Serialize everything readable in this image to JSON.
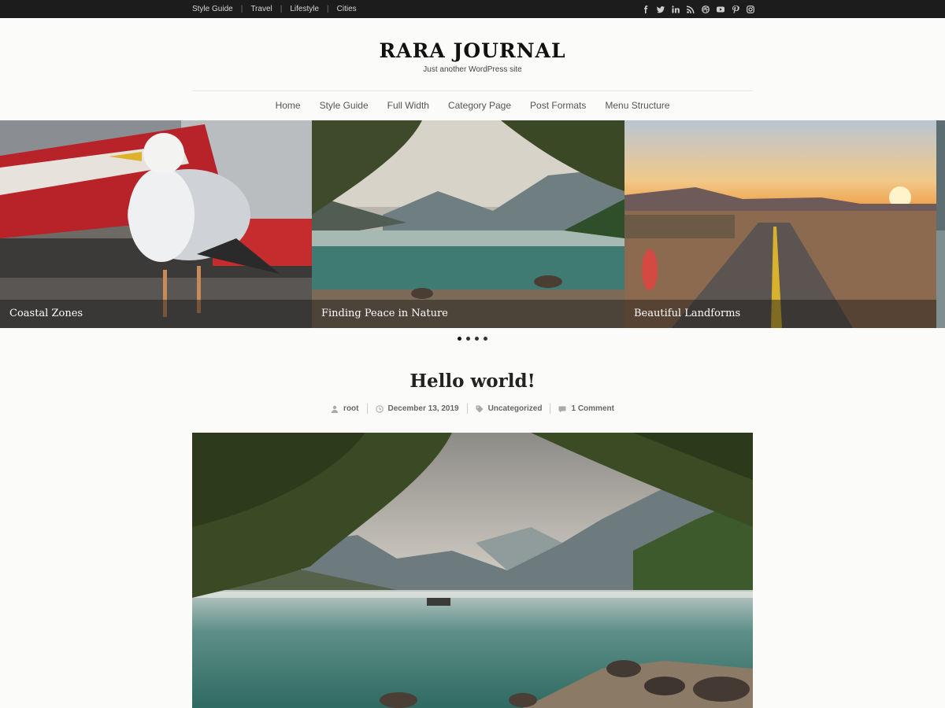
{
  "topbar": {
    "links": [
      "Style Guide",
      "Travel",
      "Lifestyle",
      "Cities"
    ],
    "social_icons": [
      "facebook-icon",
      "twitter-icon",
      "linkedin-icon",
      "rss-icon",
      "dribbble-icon",
      "youtube-icon",
      "pinterest-icon",
      "instagram-icon"
    ]
  },
  "header": {
    "title": "RARA JOURNAL",
    "tagline": "Just another WordPress site"
  },
  "nav": {
    "items": [
      "Home",
      "Style Guide",
      "Full Width",
      "Category Page",
      "Post Formats",
      "Menu Structure"
    ]
  },
  "slider": {
    "slides": [
      {
        "caption": "Coastal Zones"
      },
      {
        "caption": "Finding Peace in Nature"
      },
      {
        "caption": "Beautiful Landforms"
      }
    ],
    "dots_count": 4,
    "active_dot": 1
  },
  "post": {
    "title": "Hello world!",
    "author": "root",
    "date": "December 13, 2019",
    "category": "Uncategorized",
    "comments": "1 Comment"
  },
  "colors": {
    "topbar_bg": "#1c1c1c",
    "page_bg": "#fbfbf9",
    "caption_overlay": "rgba(20,20,20,0.45)"
  }
}
